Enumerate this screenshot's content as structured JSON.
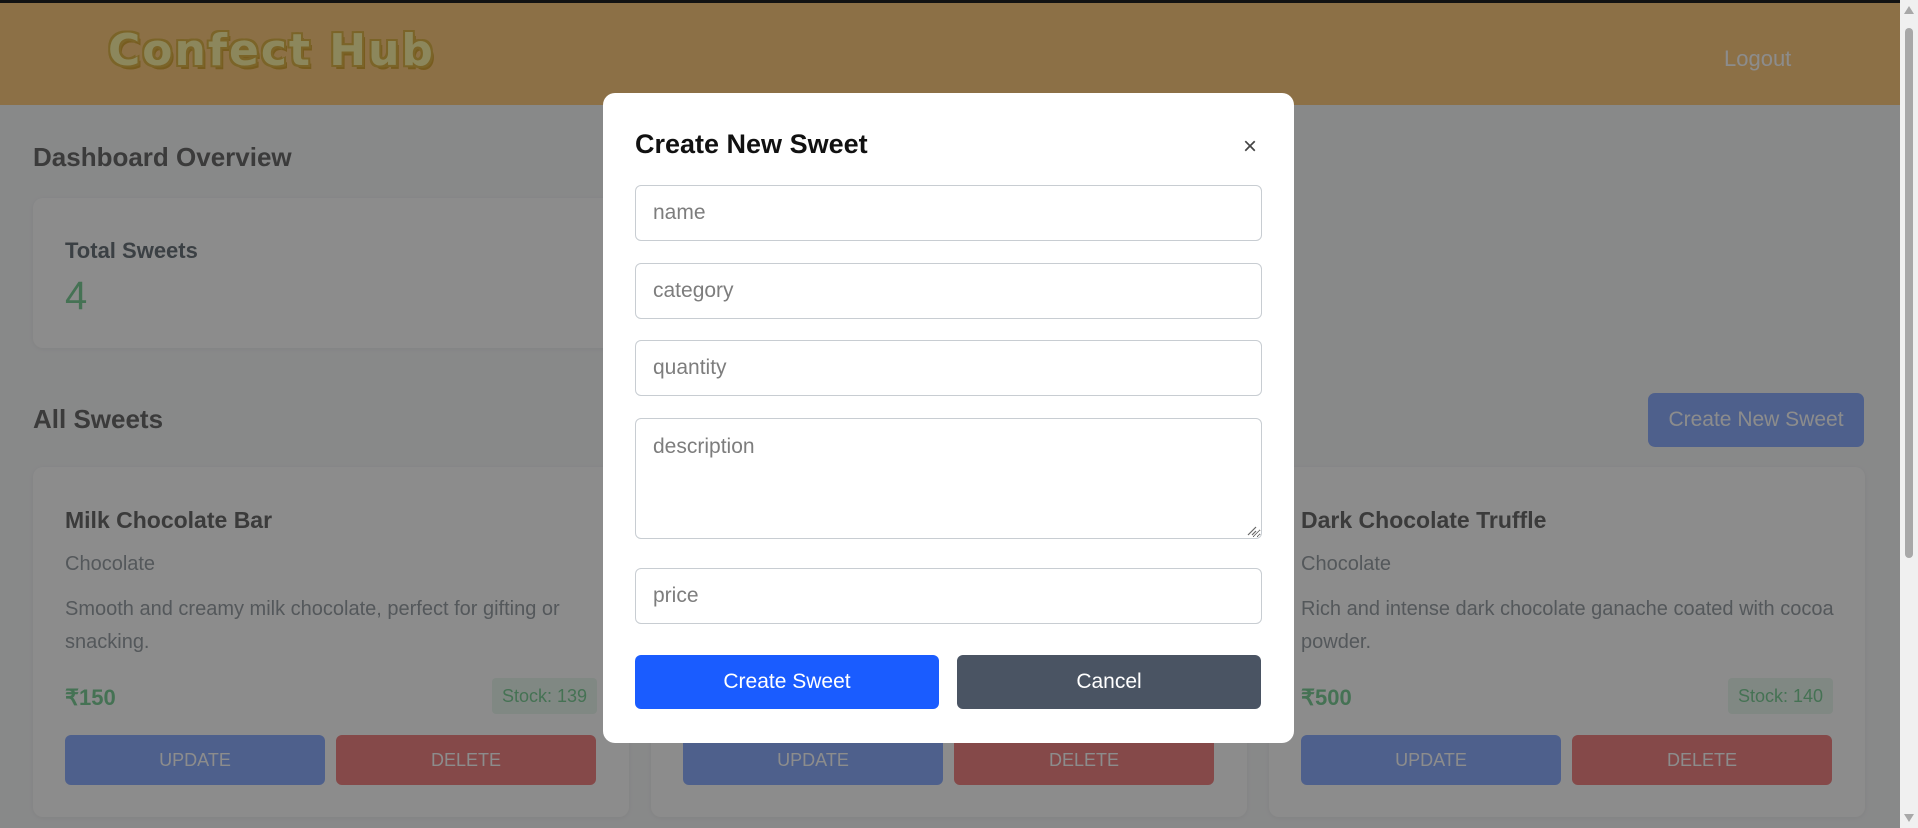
{
  "header": {
    "logo_text": "Confect Hub",
    "logout_label": "Logout"
  },
  "dashboard": {
    "title": "Dashboard Overview",
    "stats": [
      {
        "label": "Total Sweets",
        "value": "4"
      }
    ]
  },
  "sweets_section": {
    "title": "All Sweets",
    "create_button_label": "Create New Sweet",
    "items": [
      {
        "name": "Milk Chocolate Bar",
        "category": "Chocolate",
        "description": "Smooth and creamy milk chocolate, perfect for gifting or snacking.",
        "price": "₹150",
        "stock": "Stock: 139",
        "update_label": "UPDATE",
        "delete_label": "DELETE"
      },
      {
        "name": "",
        "category": "",
        "description": "",
        "price": "",
        "stock": "",
        "update_label": "UPDATE",
        "delete_label": "DELETE"
      },
      {
        "name": "Dark Chocolate Truffle",
        "category": "Chocolate",
        "description": "Rich and intense dark chocolate ganache coated with cocoa powder.",
        "price": "₹500",
        "stock": "Stock: 140",
        "update_label": "UPDATE",
        "delete_label": "DELETE"
      }
    ]
  },
  "modal": {
    "title": "Create New Sweet",
    "close_glyph": "×",
    "fields": {
      "name_placeholder": "name",
      "category_placeholder": "category",
      "quantity_placeholder": "quantity",
      "description_placeholder": "description",
      "price_placeholder": "price"
    },
    "submit_label": "Create Sweet",
    "cancel_label": "Cancel"
  },
  "colors": {
    "header_bg": "#ffcc80",
    "accent_green": "#7fcf99",
    "primary_blue": "#1a5cff",
    "update_blue": "#8fb0ff",
    "delete_red": "#f28585",
    "cancel_gray": "#4a5463"
  },
  "icons": {
    "close": "close-icon",
    "resize": "resize-grip-icon"
  }
}
